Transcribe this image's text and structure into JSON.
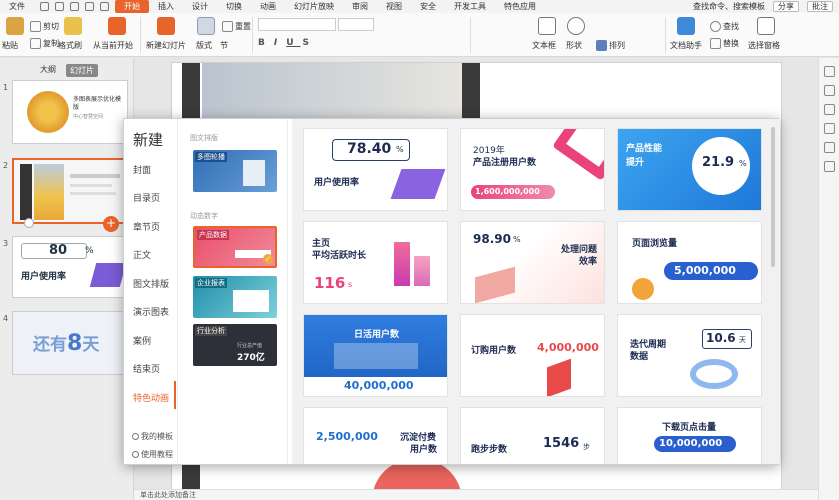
{
  "menubar": {
    "file": "文件",
    "tabs": [
      "开始",
      "插入",
      "设计",
      "切换",
      "动画",
      "幻灯片放映",
      "审阅",
      "视图",
      "安全",
      "开发工具",
      "特色应用"
    ],
    "active_tab": "开始",
    "search": "查找命令、搜索模板",
    "share": "分享",
    "comment": "批注"
  },
  "ribbon": {
    "paste": "粘贴",
    "cut": "剪切",
    "copy": "复制",
    "format_painter": "格式刷",
    "from_current": "从当前开始",
    "new_slide": "新建幻灯片",
    "layout": "版式",
    "section": "节",
    "reset": "重置",
    "textbox": "文本框",
    "shape": "形状",
    "arrange": "排列",
    "doc_assistant": "文档助手",
    "find": "查找",
    "replace": "替换",
    "select_pane": "选择窗格"
  },
  "thumbs": {
    "tab_outline": "大纲",
    "tab_slides": "幻灯片",
    "slides": [
      {
        "num": "1",
        "title": "多图表展示优化模版",
        "sub": "中心智慧空间"
      },
      {
        "num": "2"
      },
      {
        "num": "3",
        "value": "80",
        "unit": "%",
        "label": "用户使用率"
      },
      {
        "num": "4",
        "text1": "还有",
        "text2": "8",
        "text3": "天"
      }
    ]
  },
  "dialog": {
    "title": "新建",
    "nav": [
      "封面",
      "目录页",
      "章节页",
      "正文",
      "图文排版",
      "演示图表",
      "案例",
      "结束页",
      "特色动画"
    ],
    "active_nav": "特色动画",
    "footer": [
      "我的模板",
      "使用教程"
    ],
    "categories": [
      {
        "section": "图文排版",
        "items": [
          {
            "label": "多图轮播"
          }
        ]
      },
      {
        "section": "动态数字",
        "items": [
          {
            "label": "产品数据"
          },
          {
            "label": "企业报表"
          },
          {
            "label": "行业分析",
            "value": "270亿",
            "caption": "行业总产值"
          }
        ]
      }
    ],
    "cards": [
      {
        "value": "78.40",
        "unit": "%",
        "label": "用户使用率"
      },
      {
        "year": "2019年",
        "title": "产品注册用户数",
        "value": "1,600,000,000"
      },
      {
        "title1": "产品性能",
        "title2": "提升",
        "value": "21.9",
        "unit": "%"
      },
      {
        "title1": "主页",
        "title2": "平均活跃时长",
        "value": "116",
        "unit": "s"
      },
      {
        "value": "98.90",
        "unit": "%",
        "title1": "处理问题",
        "title2": "效率"
      },
      {
        "title": "页面浏览量",
        "value": "5,000,000"
      },
      {
        "title": "日活用户数",
        "value": "40,000,000"
      },
      {
        "title": "订购用户数",
        "value": "4,000,000"
      },
      {
        "title1": "迭代周期",
        "title2": "数据",
        "value": "10.6",
        "unit": "天"
      },
      {
        "value": "2,500,000",
        "title1": "沉淀付费",
        "title2": "用户数"
      },
      {
        "title": "跑步步数",
        "value": "1546",
        "unit": "步"
      },
      {
        "title": "下载页点击量",
        "value": "10,000,000"
      }
    ]
  },
  "status": {
    "text": "单击此处添加备注"
  }
}
